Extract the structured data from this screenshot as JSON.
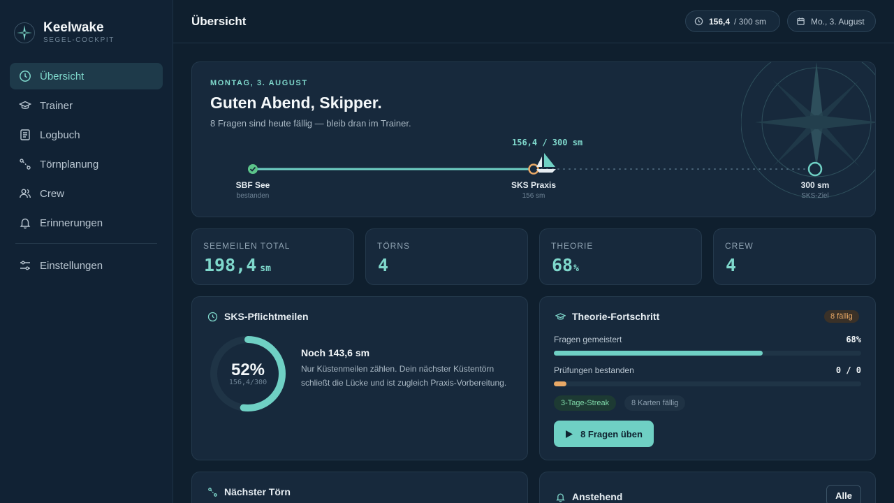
{
  "app": {
    "name": "Keelwake",
    "subtitle": "SEGEL-COCKPIT"
  },
  "sidebar": {
    "items": [
      {
        "label": "Übersicht",
        "icon": "compass-icon",
        "active": true
      },
      {
        "label": "Trainer",
        "icon": "graduation-cap-icon"
      },
      {
        "label": "Logbuch",
        "icon": "book-icon"
      },
      {
        "label": "Törnplanung",
        "icon": "route-icon"
      },
      {
        "label": "Crew",
        "icon": "users-icon"
      },
      {
        "label": "Erinnerungen",
        "icon": "bell-icon"
      }
    ],
    "settings": {
      "label": "Einstellungen",
      "icon": "sliders-icon"
    }
  },
  "topbar": {
    "title": "Übersicht",
    "miles": {
      "value": "156,4",
      "total": "/ 300 sm"
    },
    "date": "Mo., 3. August"
  },
  "hero": {
    "eyebrow": "MONTAG, 3. AUGUST",
    "greeting": "Guten Abend, Skipper.",
    "subtitle": "8 Fragen sind heute fällig — bleib dran im Trainer.",
    "route_label": "156,4 / 300 sm",
    "progress_fraction": 0.5213,
    "stops": [
      {
        "name": "SBF See",
        "sub": "bestanden"
      },
      {
        "name": "SKS Praxis",
        "sub": "156 sm"
      },
      {
        "name": "300 sm",
        "sub": "SKS-Ziel"
      }
    ]
  },
  "stats": [
    {
      "label": "SEEMEILEN TOTAL",
      "value": "198,4",
      "unit": "sm"
    },
    {
      "label": "TÖRNS",
      "value": "4",
      "unit": ""
    },
    {
      "label": "THEORIE",
      "value": "68",
      "unit": "%"
    },
    {
      "label": "CREW",
      "value": "4",
      "unit": ""
    }
  ],
  "sks": {
    "title": "SKS-Pflichtmeilen",
    "percent_label": "52%",
    "sub_label": "156,4/300",
    "percent": 52,
    "headline": "Noch 143,6 sm",
    "text": "Nur Küstenmeilen zählen. Dein nächster Küstentörn schließt die Lücke und ist zugleich Praxis-Vorbereitung."
  },
  "theory": {
    "title": "Theorie-Fortschritt",
    "badge": "8 fällig",
    "rows": [
      {
        "label": "Fragen gemeistert",
        "value": "68%",
        "fraction": 0.68,
        "color": "#6fd0c4"
      },
      {
        "label": "Prüfungen bestanden",
        "value": "0 / 0",
        "fraction": 0.04,
        "color": "#e8a866"
      }
    ],
    "chips": [
      "3-Tage-Streak",
      "8 Karten fällig"
    ],
    "cta": "8 Fragen üben"
  },
  "next_trip": {
    "title": "Nächster Törn"
  },
  "upcoming": {
    "title": "Anstehend",
    "button": "Alle"
  },
  "colors": {
    "accent": "#6fd0c4",
    "warning": "#e8a866",
    "success": "#5cc48a"
  }
}
